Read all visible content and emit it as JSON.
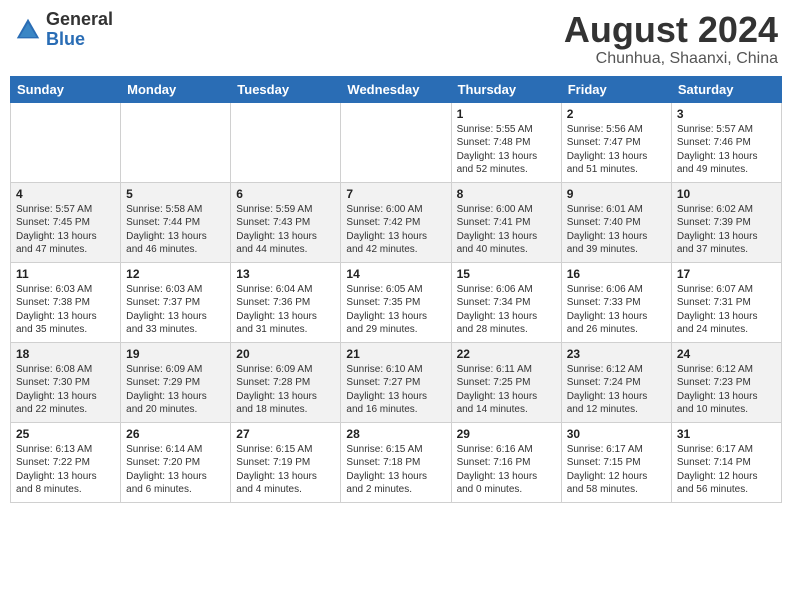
{
  "header": {
    "logo_line1": "General",
    "logo_line2": "Blue",
    "month_year": "August 2024",
    "location": "Chunhua, Shaanxi, China"
  },
  "weekdays": [
    "Sunday",
    "Monday",
    "Tuesday",
    "Wednesday",
    "Thursday",
    "Friday",
    "Saturday"
  ],
  "weeks": [
    [
      {
        "day": "",
        "info": ""
      },
      {
        "day": "",
        "info": ""
      },
      {
        "day": "",
        "info": ""
      },
      {
        "day": "",
        "info": ""
      },
      {
        "day": "1",
        "info": "Sunrise: 5:55 AM\nSunset: 7:48 PM\nDaylight: 13 hours\nand 52 minutes."
      },
      {
        "day": "2",
        "info": "Sunrise: 5:56 AM\nSunset: 7:47 PM\nDaylight: 13 hours\nand 51 minutes."
      },
      {
        "day": "3",
        "info": "Sunrise: 5:57 AM\nSunset: 7:46 PM\nDaylight: 13 hours\nand 49 minutes."
      }
    ],
    [
      {
        "day": "4",
        "info": "Sunrise: 5:57 AM\nSunset: 7:45 PM\nDaylight: 13 hours\nand 47 minutes."
      },
      {
        "day": "5",
        "info": "Sunrise: 5:58 AM\nSunset: 7:44 PM\nDaylight: 13 hours\nand 46 minutes."
      },
      {
        "day": "6",
        "info": "Sunrise: 5:59 AM\nSunset: 7:43 PM\nDaylight: 13 hours\nand 44 minutes."
      },
      {
        "day": "7",
        "info": "Sunrise: 6:00 AM\nSunset: 7:42 PM\nDaylight: 13 hours\nand 42 minutes."
      },
      {
        "day": "8",
        "info": "Sunrise: 6:00 AM\nSunset: 7:41 PM\nDaylight: 13 hours\nand 40 minutes."
      },
      {
        "day": "9",
        "info": "Sunrise: 6:01 AM\nSunset: 7:40 PM\nDaylight: 13 hours\nand 39 minutes."
      },
      {
        "day": "10",
        "info": "Sunrise: 6:02 AM\nSunset: 7:39 PM\nDaylight: 13 hours\nand 37 minutes."
      }
    ],
    [
      {
        "day": "11",
        "info": "Sunrise: 6:03 AM\nSunset: 7:38 PM\nDaylight: 13 hours\nand 35 minutes."
      },
      {
        "day": "12",
        "info": "Sunrise: 6:03 AM\nSunset: 7:37 PM\nDaylight: 13 hours\nand 33 minutes."
      },
      {
        "day": "13",
        "info": "Sunrise: 6:04 AM\nSunset: 7:36 PM\nDaylight: 13 hours\nand 31 minutes."
      },
      {
        "day": "14",
        "info": "Sunrise: 6:05 AM\nSunset: 7:35 PM\nDaylight: 13 hours\nand 29 minutes."
      },
      {
        "day": "15",
        "info": "Sunrise: 6:06 AM\nSunset: 7:34 PM\nDaylight: 13 hours\nand 28 minutes."
      },
      {
        "day": "16",
        "info": "Sunrise: 6:06 AM\nSunset: 7:33 PM\nDaylight: 13 hours\nand 26 minutes."
      },
      {
        "day": "17",
        "info": "Sunrise: 6:07 AM\nSunset: 7:31 PM\nDaylight: 13 hours\nand 24 minutes."
      }
    ],
    [
      {
        "day": "18",
        "info": "Sunrise: 6:08 AM\nSunset: 7:30 PM\nDaylight: 13 hours\nand 22 minutes."
      },
      {
        "day": "19",
        "info": "Sunrise: 6:09 AM\nSunset: 7:29 PM\nDaylight: 13 hours\nand 20 minutes."
      },
      {
        "day": "20",
        "info": "Sunrise: 6:09 AM\nSunset: 7:28 PM\nDaylight: 13 hours\nand 18 minutes."
      },
      {
        "day": "21",
        "info": "Sunrise: 6:10 AM\nSunset: 7:27 PM\nDaylight: 13 hours\nand 16 minutes."
      },
      {
        "day": "22",
        "info": "Sunrise: 6:11 AM\nSunset: 7:25 PM\nDaylight: 13 hours\nand 14 minutes."
      },
      {
        "day": "23",
        "info": "Sunrise: 6:12 AM\nSunset: 7:24 PM\nDaylight: 13 hours\nand 12 minutes."
      },
      {
        "day": "24",
        "info": "Sunrise: 6:12 AM\nSunset: 7:23 PM\nDaylight: 13 hours\nand 10 minutes."
      }
    ],
    [
      {
        "day": "25",
        "info": "Sunrise: 6:13 AM\nSunset: 7:22 PM\nDaylight: 13 hours\nand 8 minutes."
      },
      {
        "day": "26",
        "info": "Sunrise: 6:14 AM\nSunset: 7:20 PM\nDaylight: 13 hours\nand 6 minutes."
      },
      {
        "day": "27",
        "info": "Sunrise: 6:15 AM\nSunset: 7:19 PM\nDaylight: 13 hours\nand 4 minutes."
      },
      {
        "day": "28",
        "info": "Sunrise: 6:15 AM\nSunset: 7:18 PM\nDaylight: 13 hours\nand 2 minutes."
      },
      {
        "day": "29",
        "info": "Sunrise: 6:16 AM\nSunset: 7:16 PM\nDaylight: 13 hours\nand 0 minutes."
      },
      {
        "day": "30",
        "info": "Sunrise: 6:17 AM\nSunset: 7:15 PM\nDaylight: 12 hours\nand 58 minutes."
      },
      {
        "day": "31",
        "info": "Sunrise: 6:17 AM\nSunset: 7:14 PM\nDaylight: 12 hours\nand 56 minutes."
      }
    ]
  ]
}
